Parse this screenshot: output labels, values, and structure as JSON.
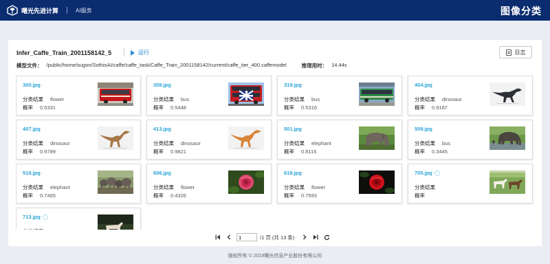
{
  "header": {
    "brand": "曙光先进计算",
    "subtitle": "AI服务",
    "page_title": "图像分类"
  },
  "job": {
    "name": "Infer_Caffe_Train_2001158142_5",
    "run_label": "运行",
    "log_label": "日志",
    "model_key": "模型文件：",
    "model_path": "/public/home/sugon/SothisAI/caffe/caffe_task/Caffe_Train_2001158142/current/caffe_iter_400.caffemodel",
    "time_key": "推理用时：",
    "time_value": "14.44s"
  },
  "labels": {
    "class_key": "分类结果",
    "prob_key": "概率"
  },
  "results": [
    {
      "file": "300.jpg",
      "class": "flower",
      "prob": "0.5331",
      "thumb": "bus-red",
      "loading": false
    },
    {
      "file": "308.jpg",
      "class": "bus",
      "prob": "0.5448",
      "thumb": "bus-uk",
      "loading": false
    },
    {
      "file": "319.jpg",
      "class": "bus",
      "prob": "0.5316",
      "thumb": "bus-green",
      "loading": false
    },
    {
      "file": "404.jpg",
      "class": "dinosaur",
      "prob": "0.9187",
      "thumb": "dino-dark",
      "loading": false
    },
    {
      "file": "407.jpg",
      "class": "dinosaur",
      "prob": "0.9789",
      "thumb": "dino-tan",
      "loading": false
    },
    {
      "file": "413.jpg",
      "class": "dinosaur",
      "prob": "0.9821",
      "thumb": "dino-orange",
      "loading": false
    },
    {
      "file": "501.jpg",
      "class": "elephant",
      "prob": "0.8116",
      "thumb": "elephant",
      "loading": false
    },
    {
      "file": "509.jpg",
      "class": "bus",
      "prob": "0.3445",
      "thumb": "elephant-water",
      "loading": false
    },
    {
      "file": "518.jpg",
      "class": "elephant",
      "prob": "0.7465",
      "thumb": "elephant-herd",
      "loading": false
    },
    {
      "file": "606.jpg",
      "class": "flower",
      "prob": "0.4326",
      "thumb": "rose-pink",
      "loading": false
    },
    {
      "file": "618.jpg",
      "class": "flower",
      "prob": "0.7593",
      "thumb": "rose-red",
      "loading": false
    },
    {
      "file": "705.jpg",
      "class": "",
      "prob": "",
      "thumb": "horses",
      "loading": true
    },
    {
      "file": "713.jpg",
      "class": "",
      "prob": "",
      "thumb": "horse-dark",
      "loading": true
    }
  ],
  "pagination": {
    "current_page": "1",
    "summary": "/1 页 (共 13 条)"
  },
  "footer": "版权所有 © 2019曙光信息产业股份有限公司"
}
